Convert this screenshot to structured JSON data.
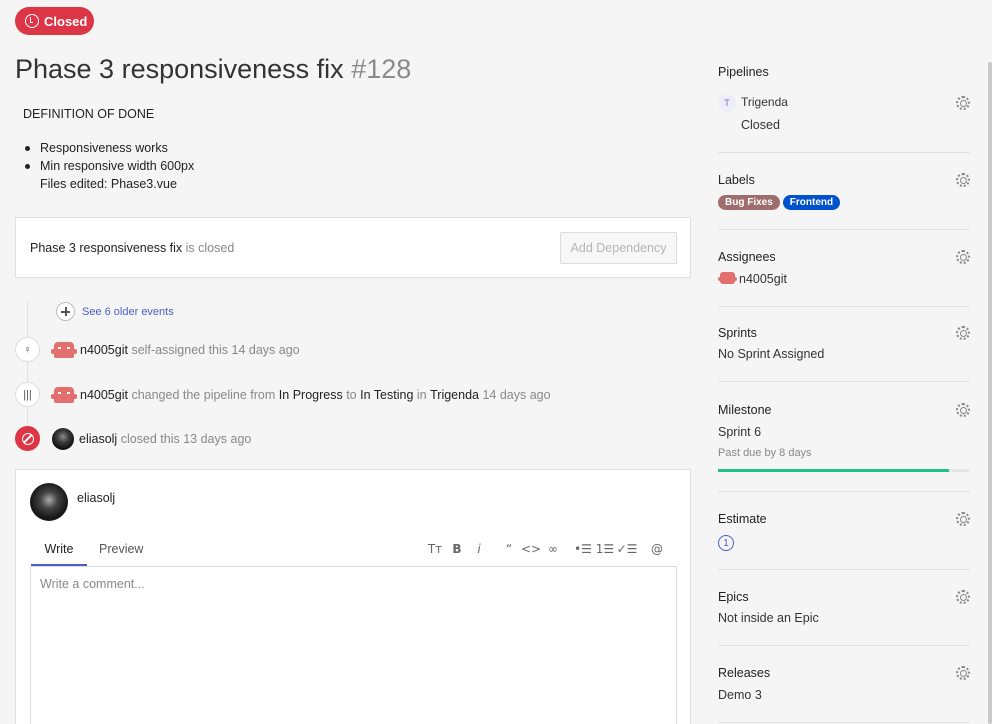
{
  "issue": {
    "status": "Closed",
    "title": "Phase 3 responsiveness fix",
    "number": "#128",
    "description_heading": "DEFINITION OF DONE",
    "description_items": [
      "Responsiveness works",
      "Min responsive width 600px"
    ],
    "description_extra": "Files edited: Phase3.vue"
  },
  "dependency": {
    "issue_name": "Phase 3 responsiveness fix",
    "status_text": "is closed",
    "button_label": "Add Dependency"
  },
  "timeline": {
    "older_events_label": "See 6 older events",
    "events": [
      {
        "user": "n4005git",
        "text": "self-assigned this 14 days ago"
      },
      {
        "user": "n4005git",
        "pre": "changed the pipeline from",
        "from": "In Progress",
        "mid": "to",
        "to": "In Testing",
        "in": "in",
        "pipeline": "Trigenda",
        "time": "14 days ago"
      },
      {
        "user": "eliasolj",
        "text": "closed this 13 days ago"
      }
    ]
  },
  "comment": {
    "user": "eliasolj",
    "tab_write": "Write",
    "tab_preview": "Preview",
    "placeholder": "Write a comment...",
    "toolbar_icons": [
      "text-size-icon",
      "bold-icon",
      "italic-icon",
      "quote-icon",
      "code-icon",
      "link-icon",
      "bulleted-list-icon",
      "numbered-list-icon",
      "task-list-icon",
      "mention-icon"
    ],
    "toolbar_glyphs": [
      "Tт",
      "B",
      "i",
      "“",
      "<>",
      "∞",
      "•☰",
      "1☰",
      "✓☰",
      "@"
    ]
  },
  "sidebar": {
    "pipelines": {
      "title": "Pipelines",
      "workspace_initial": "T",
      "workspace": "Trigenda",
      "status": "Closed"
    },
    "labels": {
      "title": "Labels",
      "items": [
        {
          "name": "Bug Fixes",
          "color": "#9e6d6d"
        },
        {
          "name": "Frontend",
          "color": "#0052cc"
        }
      ]
    },
    "assignees": {
      "title": "Assignees",
      "user": "n4005git"
    },
    "sprints": {
      "title": "Sprints",
      "value": "No Sprint Assigned"
    },
    "milestone": {
      "title": "Milestone",
      "value": "Sprint 6",
      "due": "Past due by 8 days",
      "progress": 0.92
    },
    "estimate": {
      "title": "Estimate",
      "value": "1"
    },
    "epics": {
      "title": "Epics",
      "value": "Not inside an Epic"
    },
    "releases": {
      "title": "Releases",
      "value": "Demo 3"
    }
  },
  "colors": {
    "accent": "#4a5fc1",
    "closed": "#dc3545",
    "progress": "#21c08b"
  }
}
